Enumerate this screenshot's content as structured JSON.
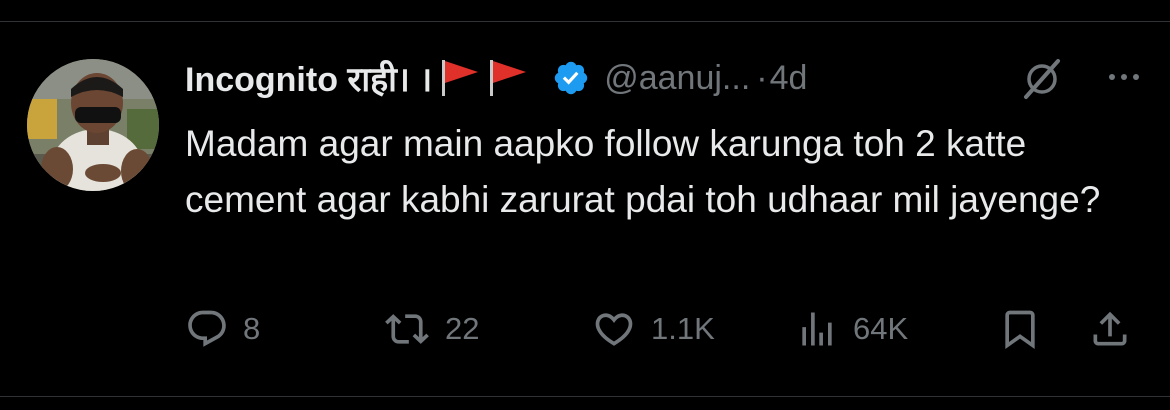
{
  "tweet": {
    "display_name": "Incognito राही। ।",
    "handle": "@aanuj...",
    "separator": "·",
    "time": "4d",
    "text": "Madam agar main aapko follow karunga toh 2 katte cement agar kabhi zarurat pdai toh udhaar mil jayenge?",
    "icons": {
      "flags": [
        "red-flag-icon",
        "red-flag-icon"
      ],
      "verified": "verified-badge-icon",
      "grok": "grok-icon",
      "more": "more-icon"
    }
  },
  "actions": {
    "replies": {
      "icon": "reply-icon",
      "count": "8"
    },
    "reposts": {
      "icon": "repost-icon",
      "count": "22"
    },
    "likes": {
      "icon": "like-icon",
      "count": "1.1K"
    },
    "views": {
      "icon": "views-icon",
      "count": "64K"
    },
    "bookmark": {
      "icon": "bookmark-icon"
    },
    "share": {
      "icon": "share-icon"
    }
  },
  "colors": {
    "background": "#000000",
    "text": "#e7e9ea",
    "muted": "#71767b",
    "verified_blue": "#1d9bf0",
    "flag_red": "#e0302a"
  }
}
